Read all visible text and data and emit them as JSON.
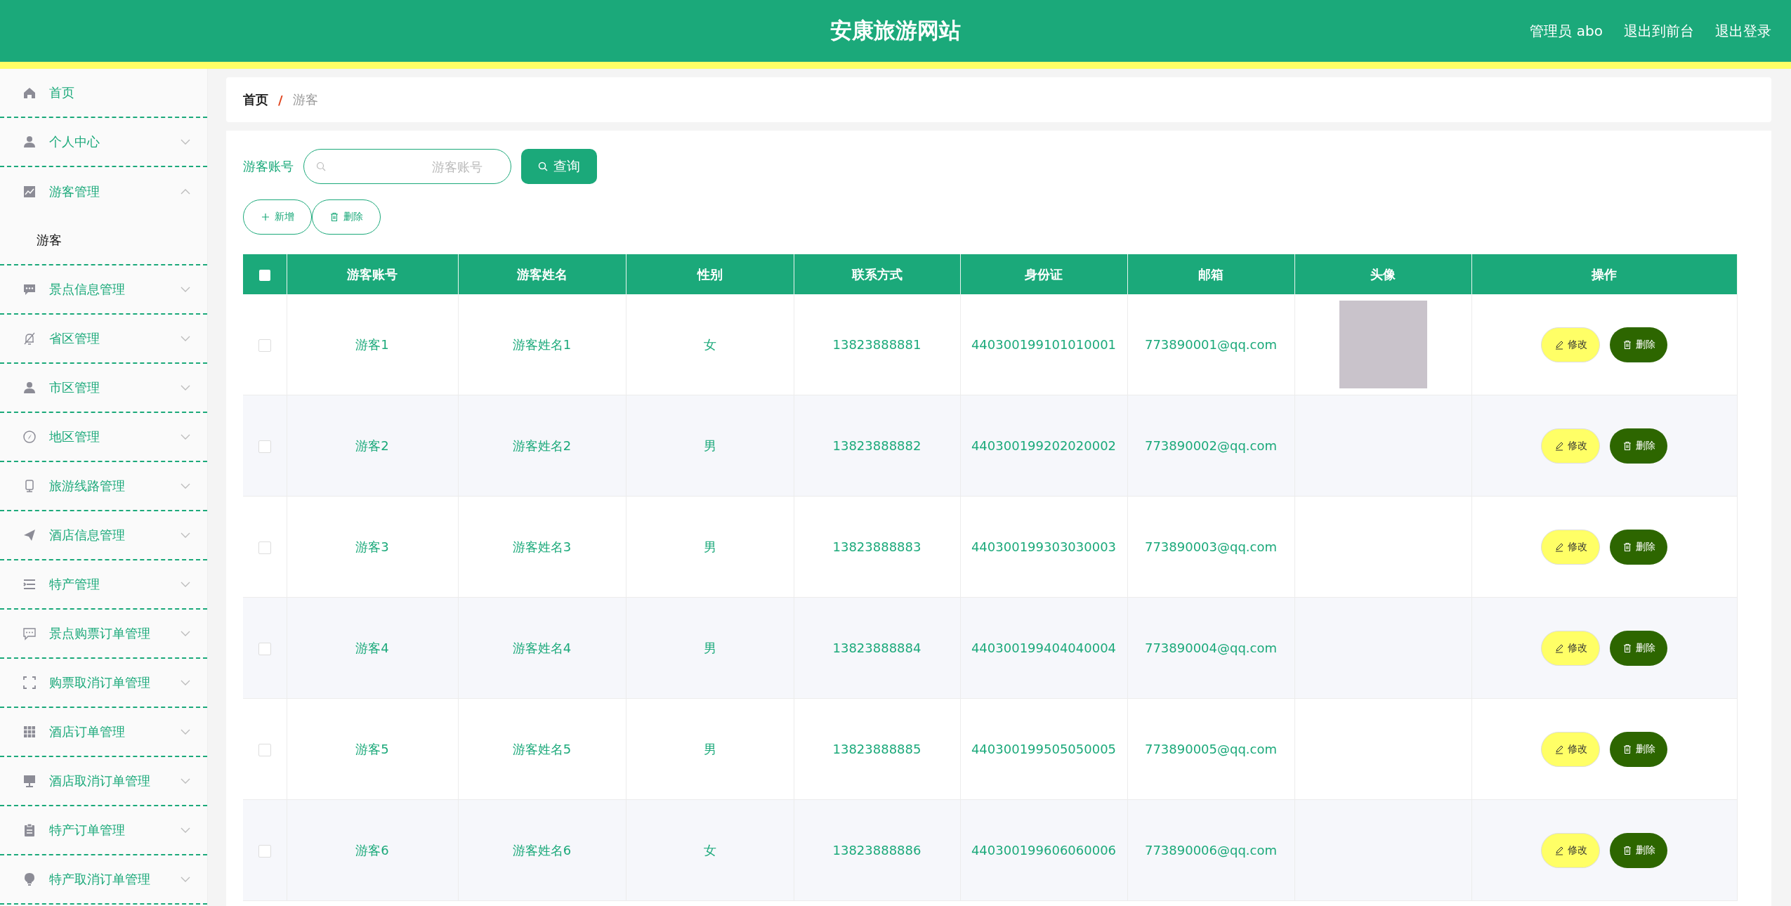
{
  "header": {
    "title": "安康旅游网站",
    "user": "管理员 abo",
    "links": [
      "退出到前台",
      "退出登录"
    ]
  },
  "sidebar": {
    "items": [
      {
        "label": "首页",
        "expandable": false,
        "expanded": false
      },
      {
        "label": "个人中心",
        "expandable": true,
        "expanded": false
      },
      {
        "label": "游客管理",
        "expandable": true,
        "expanded": true,
        "children": [
          {
            "label": "游客",
            "selected": true
          }
        ]
      },
      {
        "label": "景点信息管理",
        "expandable": true,
        "expanded": false
      },
      {
        "label": "省区管理",
        "expandable": true,
        "expanded": false
      },
      {
        "label": "市区管理",
        "expandable": true,
        "expanded": false
      },
      {
        "label": "地区管理",
        "expandable": true,
        "expanded": false
      },
      {
        "label": "旅游线路管理",
        "expandable": true,
        "expanded": false
      },
      {
        "label": "酒店信息管理",
        "expandable": true,
        "expanded": false
      },
      {
        "label": "特产管理",
        "expandable": true,
        "expanded": false
      },
      {
        "label": "景点购票订单管理",
        "expandable": true,
        "expanded": false
      },
      {
        "label": "购票取消订单管理",
        "expandable": true,
        "expanded": false
      },
      {
        "label": "酒店订单管理",
        "expandable": true,
        "expanded": false
      },
      {
        "label": "酒店取消订单管理",
        "expandable": true,
        "expanded": false
      },
      {
        "label": "特产订单管理",
        "expandable": true,
        "expanded": false
      },
      {
        "label": "特产取消订单管理",
        "expandable": true,
        "expanded": false
      }
    ]
  },
  "breadcrumb": [
    "首页",
    "/",
    "游客"
  ],
  "search": {
    "label": "游客账号",
    "placeholder": "游客账号",
    "button": "查询"
  },
  "actions": [
    "新增",
    "删除"
  ],
  "table": {
    "select_all_checked": false,
    "columns": [
      "游客账号",
      "游客姓名",
      "性别",
      "联系方式",
      "身份证",
      "邮箱",
      "头像",
      "操作"
    ],
    "rows": [
      {
        "checked": false,
        "cells": [
          "游客1",
          "游客姓名1",
          "女",
          "13823888881",
          "440300199101010001",
          "773890001@qq.com"
        ],
        "photo": true,
        "edit": "修改",
        "delete": "删除"
      },
      {
        "checked": false,
        "cells": [
          "游客2",
          "游客姓名2",
          "男",
          "13823888882",
          "440300199202020002",
          "773890002@qq.com"
        ],
        "photo": false,
        "edit": "修改",
        "delete": "删除"
      },
      {
        "checked": false,
        "cells": [
          "游客3",
          "游客姓名3",
          "男",
          "13823888883",
          "440300199303030003",
          "773890003@qq.com"
        ],
        "photo": false,
        "edit": "修改",
        "delete": "删除"
      },
      {
        "checked": false,
        "cells": [
          "游客4",
          "游客姓名4",
          "男",
          "13823888884",
          "440300199404040004",
          "773890004@qq.com"
        ],
        "photo": false,
        "edit": "修改",
        "delete": "删除"
      },
      {
        "checked": false,
        "cells": [
          "游客5",
          "游客姓名5",
          "男",
          "13823888885",
          "440300199505050005",
          "773890005@qq.com"
        ],
        "photo": false,
        "edit": "修改",
        "delete": "删除"
      },
      {
        "checked": false,
        "cells": [
          "游客6",
          "游客姓名6",
          "女",
          "13823888886",
          "440300199606060006",
          "773890006@qq.com"
        ],
        "photo": false,
        "edit": "修改",
        "delete": "删除"
      }
    ]
  }
}
